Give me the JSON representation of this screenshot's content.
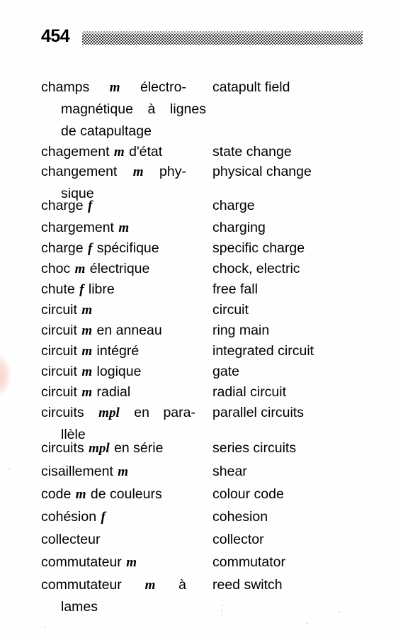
{
  "page": {
    "folio": "454",
    "background_color": "#fefefe",
    "text_color": "#000000",
    "rule_color": "#2b2b2b"
  },
  "entries": [
    {
      "fr_lines": [
        {
          "type": "justified",
          "parts": [
            "champs",
            "m",
            "électro-"
          ]
        },
        {
          "type": "justified-cont",
          "parts": [
            "magnétique",
            "à",
            "lignes"
          ]
        },
        {
          "type": "cont",
          "text": "de catapultage"
        }
      ],
      "fr_plain": "champs m électro-magnétique à lignes de catapultage",
      "en": "catapult field"
    },
    {
      "fr_lines": [
        {
          "type": "simple",
          "before": "chagement",
          "gender": "m",
          "after": "d'état"
        }
      ],
      "fr_plain": "chagement m d'état",
      "en": "state change"
    },
    {
      "fr_lines": [
        {
          "type": "justified",
          "parts": [
            "changement",
            "m",
            "phy-"
          ]
        },
        {
          "type": "cont",
          "text": "sique"
        }
      ],
      "fr_plain": "changement m physique",
      "en": "physical change"
    },
    {
      "fr_lines": [
        {
          "type": "simple",
          "before": "charge",
          "gender": "f",
          "after": ""
        }
      ],
      "fr_plain": "charge f",
      "en": "charge"
    },
    {
      "fr_lines": [
        {
          "type": "simple",
          "before": "chargement",
          "gender": "m",
          "after": ""
        }
      ],
      "fr_plain": "chargement m",
      "en": "charging"
    },
    {
      "fr_lines": [
        {
          "type": "simple",
          "before": "charge",
          "gender": "f",
          "after": "spécifique"
        }
      ],
      "fr_plain": "charge f spécifique",
      "en": "specific charge"
    },
    {
      "fr_lines": [
        {
          "type": "simple",
          "before": "choc",
          "gender": "m",
          "after": "électrique"
        }
      ],
      "fr_plain": "choc m électrique",
      "en": "chock, electric"
    },
    {
      "fr_lines": [
        {
          "type": "simple",
          "before": "chute",
          "gender": "f",
          "after": "libre"
        }
      ],
      "fr_plain": "chute f libre",
      "en": "free fall"
    },
    {
      "fr_lines": [
        {
          "type": "simple",
          "before": "circuit",
          "gender": "m",
          "after": ""
        }
      ],
      "fr_plain": "circuit m",
      "en": "circuit"
    },
    {
      "fr_lines": [
        {
          "type": "simple",
          "before": "circuit",
          "gender": "m",
          "after": "en anneau"
        }
      ],
      "fr_plain": "circuit m en anneau",
      "en": "ring main"
    },
    {
      "fr_lines": [
        {
          "type": "simple",
          "before": "circuit",
          "gender": "m",
          "after": "intégré"
        }
      ],
      "fr_plain": "circuit m intégré",
      "en": "integrated circuit"
    },
    {
      "fr_lines": [
        {
          "type": "simple",
          "before": "circuit",
          "gender": "m",
          "after": "logique"
        }
      ],
      "fr_plain": "circuit m logique",
      "en": "gate"
    },
    {
      "fr_lines": [
        {
          "type": "simple",
          "before": "circuit",
          "gender": "m",
          "after": "radial"
        }
      ],
      "fr_plain": "circuit m radial",
      "en": "radial circuit"
    },
    {
      "fr_lines": [
        {
          "type": "justified",
          "parts": [
            "circuits",
            "mpl",
            "en",
            "para-"
          ]
        },
        {
          "type": "cont",
          "text": "llèle"
        }
      ],
      "fr_plain": "circuits mpl en parallèle",
      "en": "parallel circuits"
    },
    {
      "fr_lines": [
        {
          "type": "simple",
          "before": "circuits",
          "gender": "mpl",
          "after": "en série"
        }
      ],
      "fr_plain": "circuits mpl en série",
      "en": "series circuits"
    },
    {
      "fr_lines": [
        {
          "type": "simple",
          "before": "cisaillement",
          "gender": "m",
          "after": ""
        }
      ],
      "fr_plain": "cisaillement m",
      "en": "shear"
    },
    {
      "fr_lines": [
        {
          "type": "simple",
          "before": "code",
          "gender": "m",
          "after": "de couleurs"
        }
      ],
      "fr_plain": "code m de couleurs",
      "en": "colour code"
    },
    {
      "fr_lines": [
        {
          "type": "simple",
          "before": "cohésion",
          "gender": "f",
          "after": ""
        }
      ],
      "fr_plain": "cohésion f",
      "en": "cohesion"
    },
    {
      "fr_lines": [
        {
          "type": "simple",
          "before": "collecteur",
          "gender": "",
          "after": ""
        }
      ],
      "fr_plain": "collecteur",
      "en": "collector"
    },
    {
      "fr_lines": [
        {
          "type": "simple",
          "before": "commutateur",
          "gender": "m",
          "after": ""
        }
      ],
      "fr_plain": "commutateur m",
      "en": "commutator"
    },
    {
      "fr_lines": [
        {
          "type": "justified",
          "parts": [
            "commutateur",
            "m",
            "à"
          ]
        },
        {
          "type": "cont",
          "text": "lames"
        }
      ],
      "fr_plain": "commutateur m à lames",
      "en": "reed switch"
    }
  ]
}
